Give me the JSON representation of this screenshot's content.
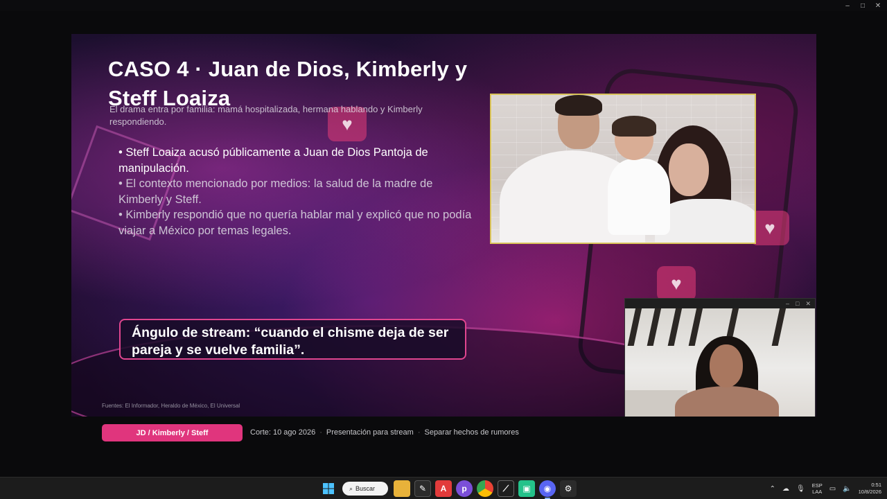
{
  "window": {
    "controls": [
      "–",
      "□",
      "✕"
    ]
  },
  "slide": {
    "title": "CASO 4 · Juan de Dios, Kimberly y Steff Loaiza",
    "subtitle": "El drama entra por familia: mamá hospitalizada, hermana hablando y Kimberly respondiendo.",
    "bullets": [
      "• Steff Loaiza acusó públicamente a Juan de Dios Pantoja de manipulación.",
      "• El contexto mencionado por medios: la salud de la madre de Kimberly y Steff.",
      "• Kimberly respondió que no quería hablar mal y explicó que no podía viajar a México por temas legales."
    ],
    "quote": "Ángulo de stream: “cuando el chisme deja de ser pareja y se vuelve familia”.",
    "sources": "Fuentes: El Informador, Heraldo de México, El Universal"
  },
  "footer": {
    "pill": "JD / Kimberly / Steff",
    "meta": [
      "Corte: 10 ago 2026",
      "Presentación para stream",
      "Separar hechos de rumores"
    ],
    "separator": "·"
  },
  "webcam": {
    "controls": [
      "–",
      "□",
      "✕"
    ]
  },
  "taskbar": {
    "search_label": "Buscar",
    "lang_top": "ESP",
    "lang_bottom": "LAA",
    "time": "0:51",
    "date": "10/8/2026",
    "accent": "#e0357d"
  }
}
